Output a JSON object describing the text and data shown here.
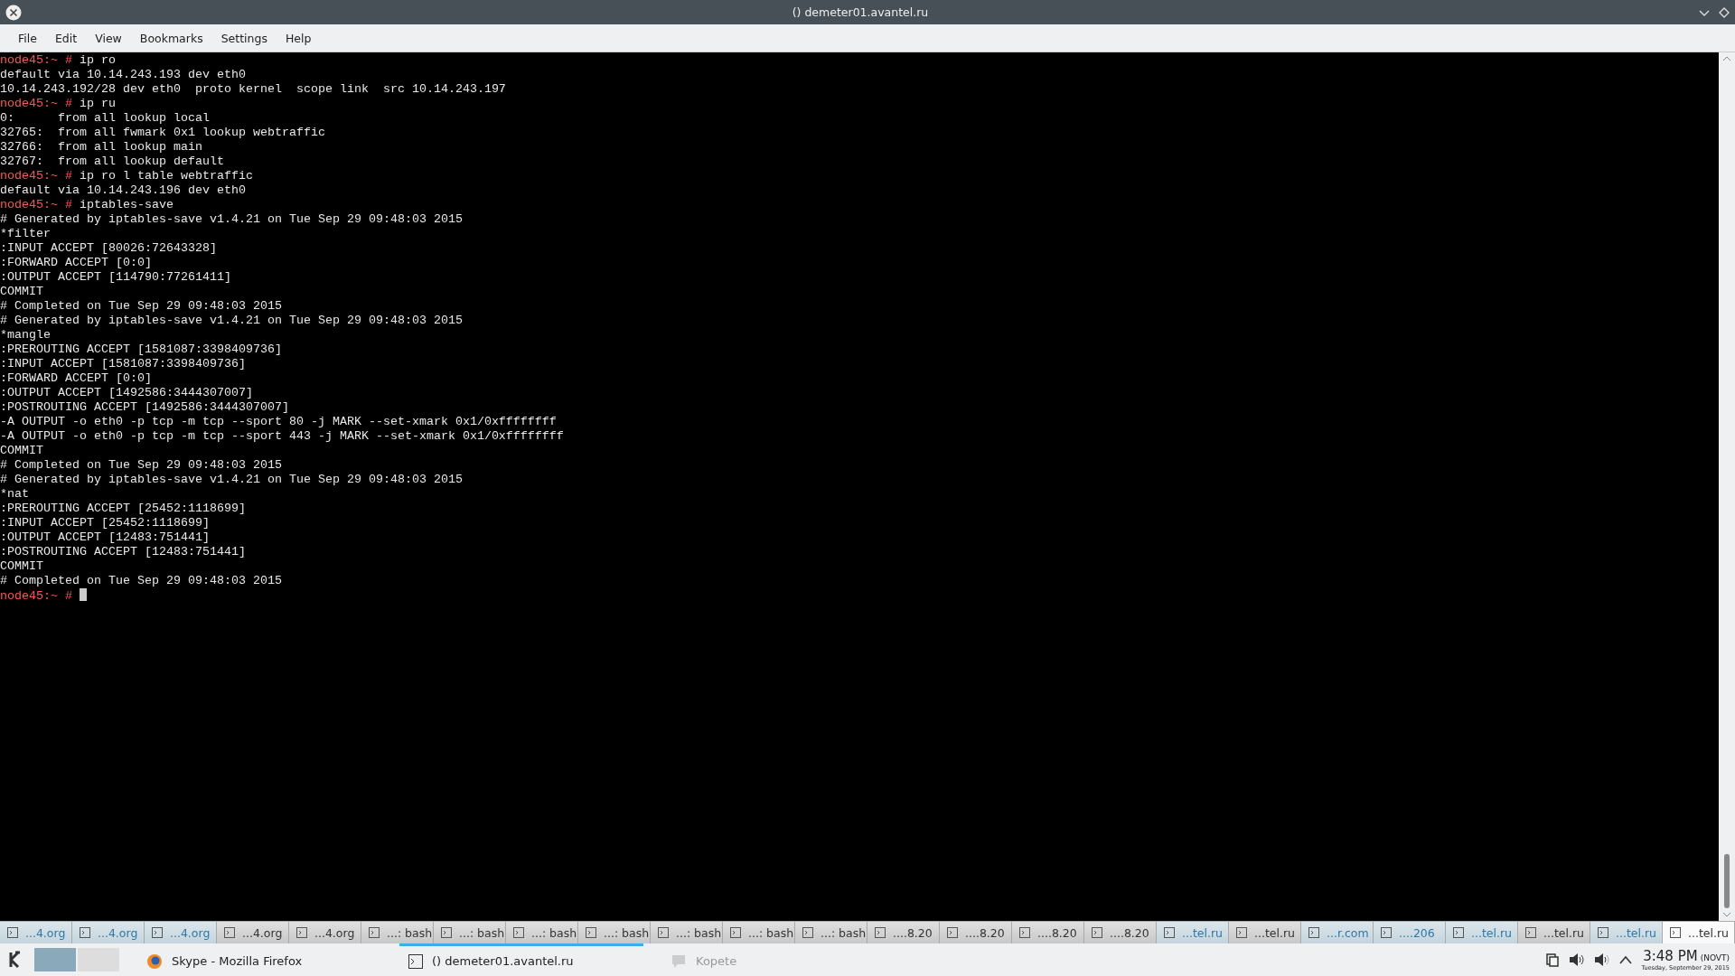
{
  "window": {
    "title": "() demeter01.avantel.ru"
  },
  "menu": [
    "File",
    "Edit",
    "View",
    "Bookmarks",
    "Settings",
    "Help"
  ],
  "terminal": {
    "lines": [
      {
        "kind": "prompt",
        "prompt": "node45:~ #",
        "command": "ip ro"
      },
      {
        "kind": "output",
        "text": "default via 10.14.243.193 dev eth0"
      },
      {
        "kind": "output",
        "text": "10.14.243.192/28 dev eth0  proto kernel  scope link  src 10.14.243.197"
      },
      {
        "kind": "prompt",
        "prompt": "node45:~ #",
        "command": "ip ru"
      },
      {
        "kind": "output",
        "text": "0:      from all lookup local"
      },
      {
        "kind": "output",
        "text": "32765:  from all fwmark 0x1 lookup webtraffic"
      },
      {
        "kind": "output",
        "text": "32766:  from all lookup main"
      },
      {
        "kind": "output",
        "text": "32767:  from all lookup default"
      },
      {
        "kind": "prompt",
        "prompt": "node45:~ #",
        "command": "ip ro l table webtraffic"
      },
      {
        "kind": "output",
        "text": "default via 10.14.243.196 dev eth0"
      },
      {
        "kind": "prompt",
        "prompt": "node45:~ #",
        "command": "iptables-save"
      },
      {
        "kind": "output",
        "text": "# Generated by iptables-save v1.4.21 on Tue Sep 29 09:48:03 2015"
      },
      {
        "kind": "output",
        "text": "*filter"
      },
      {
        "kind": "output",
        "text": ":INPUT ACCEPT [80026:72643328]"
      },
      {
        "kind": "output",
        "text": ":FORWARD ACCEPT [0:0]"
      },
      {
        "kind": "output",
        "text": ":OUTPUT ACCEPT [114790:77261411]"
      },
      {
        "kind": "output",
        "text": "COMMIT"
      },
      {
        "kind": "output",
        "text": "# Completed on Tue Sep 29 09:48:03 2015"
      },
      {
        "kind": "output",
        "text": "# Generated by iptables-save v1.4.21 on Tue Sep 29 09:48:03 2015"
      },
      {
        "kind": "output",
        "text": "*mangle"
      },
      {
        "kind": "output",
        "text": ":PREROUTING ACCEPT [1581087:3398409736]"
      },
      {
        "kind": "output",
        "text": ":INPUT ACCEPT [1581087:3398409736]"
      },
      {
        "kind": "output",
        "text": ":FORWARD ACCEPT [0:0]"
      },
      {
        "kind": "output",
        "text": ":OUTPUT ACCEPT [1492586:3444307007]"
      },
      {
        "kind": "output",
        "text": ":POSTROUTING ACCEPT [1492586:3444307007]"
      },
      {
        "kind": "output",
        "text": "-A OUTPUT -o eth0 -p tcp -m tcp --sport 80 -j MARK --set-xmark 0x1/0xffffffff"
      },
      {
        "kind": "output",
        "text": "-A OUTPUT -o eth0 -p tcp -m tcp --sport 443 -j MARK --set-xmark 0x1/0xffffffff"
      },
      {
        "kind": "output",
        "text": "COMMIT"
      },
      {
        "kind": "output",
        "text": "# Completed on Tue Sep 29 09:48:03 2015"
      },
      {
        "kind": "output",
        "text": "# Generated by iptables-save v1.4.21 on Tue Sep 29 09:48:03 2015"
      },
      {
        "kind": "output",
        "text": "*nat"
      },
      {
        "kind": "output",
        "text": ":PREROUTING ACCEPT [25452:1118699]"
      },
      {
        "kind": "output",
        "text": ":INPUT ACCEPT [25452:1118699]"
      },
      {
        "kind": "output",
        "text": ":OUTPUT ACCEPT [12483:751441]"
      },
      {
        "kind": "output",
        "text": ":POSTROUTING ACCEPT [12483:751441]"
      },
      {
        "kind": "output",
        "text": "COMMIT"
      },
      {
        "kind": "output",
        "text": "# Completed on Tue Sep 29 09:48:03 2015"
      },
      {
        "kind": "cursor",
        "prompt": "node45:~ #"
      }
    ]
  },
  "tabs": [
    {
      "label": "...4.org",
      "activity": true,
      "selected": false
    },
    {
      "label": "...4.org",
      "activity": true,
      "selected": false
    },
    {
      "label": "...4.org",
      "activity": true,
      "selected": false
    },
    {
      "label": "...4.org",
      "activity": false,
      "selected": false
    },
    {
      "label": "...4.org",
      "activity": false,
      "selected": false
    },
    {
      "label": "...: bash",
      "activity": false,
      "selected": false
    },
    {
      "label": "...: bash",
      "activity": false,
      "selected": false
    },
    {
      "label": "...: bash",
      "activity": false,
      "selected": false
    },
    {
      "label": "...: bash",
      "activity": false,
      "selected": false
    },
    {
      "label": "...: bash",
      "activity": false,
      "selected": false
    },
    {
      "label": "...: bash",
      "activity": false,
      "selected": false
    },
    {
      "label": "...: bash",
      "activity": false,
      "selected": false
    },
    {
      "label": "....8.20",
      "activity": false,
      "selected": false
    },
    {
      "label": "....8.20",
      "activity": false,
      "selected": false
    },
    {
      "label": "....8.20",
      "activity": false,
      "selected": false
    },
    {
      "label": "....8.20",
      "activity": false,
      "selected": false
    },
    {
      "label": "...tel.ru",
      "activity": true,
      "selected": false
    },
    {
      "label": "...tel.ru",
      "activity": false,
      "selected": false
    },
    {
      "label": "...r.com",
      "activity": true,
      "selected": false
    },
    {
      "label": "....206",
      "activity": true,
      "selected": false
    },
    {
      "label": "...tel.ru",
      "activity": true,
      "selected": false
    },
    {
      "label": "...tel.ru",
      "activity": false,
      "selected": false
    },
    {
      "label": "...tel.ru",
      "activity": true,
      "selected": false
    },
    {
      "label": "...tel.ru",
      "activity": false,
      "selected": true
    }
  ],
  "taskbar": {
    "desktops": [
      {
        "selected": true
      },
      {
        "selected": false
      }
    ],
    "tasks": [
      {
        "kind": "browser",
        "label": "Skype - Mozilla Firefox",
        "selected": false,
        "minimized": false
      },
      {
        "kind": "terminal",
        "label": "() demeter01.avantel.ru",
        "selected": true,
        "minimized": false
      },
      {
        "kind": "chat",
        "label": "Kopete",
        "selected": false,
        "minimized": true
      }
    ],
    "clock": {
      "time": "3:48 PM",
      "zone": "(NOVT)",
      "date": "Tuesday, September 29, 2015"
    }
  }
}
